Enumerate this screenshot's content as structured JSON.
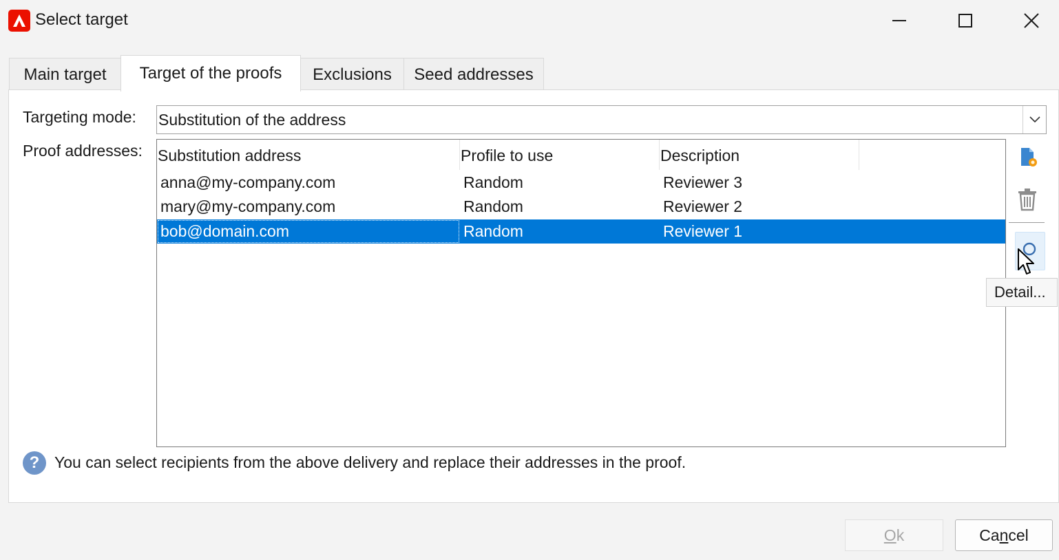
{
  "window": {
    "title": "Select target",
    "logo_icon": "adobe-logo-icon",
    "controls": [
      "minimize-icon",
      "maximize-icon",
      "close-icon"
    ]
  },
  "tabs": [
    {
      "label": "Main target",
      "active": false
    },
    {
      "label": "Target of the proofs",
      "active": true
    },
    {
      "label": "Exclusions",
      "active": false
    },
    {
      "label": "Seed addresses",
      "active": false
    }
  ],
  "form": {
    "targeting_mode_label": "Targeting mode:",
    "targeting_mode_value": "Substitution of the address",
    "proof_addresses_label": "Proof addresses:"
  },
  "table": {
    "columns": [
      "Substitution address",
      "Profile to use",
      "Description"
    ],
    "rows": [
      {
        "address": "anna@my-company.com",
        "profile": "Random",
        "description": "Reviewer 3",
        "selected": false
      },
      {
        "address": "mary@my-company.com",
        "profile": "Random",
        "description": "Reviewer 2",
        "selected": false
      },
      {
        "address": "bob@domain.com",
        "profile": "Random",
        "description": "Reviewer 1",
        "selected": true
      }
    ]
  },
  "toolbar": {
    "tooltip": "Detail...",
    "icons": [
      "add-icon",
      "delete-icon",
      "detail-icon"
    ]
  },
  "help": {
    "text": "You can select recipients from the above delivery and replace their addresses in the proof."
  },
  "buttons": {
    "ok_mnemonic": "O",
    "ok_rest": "k",
    "cancel_pre": "Ca",
    "cancel_mnemonic": "n",
    "cancel_rest": "cel"
  },
  "colors": {
    "selection": "#0078d7",
    "logo": "#eb1000",
    "help": "#6f95c9"
  }
}
